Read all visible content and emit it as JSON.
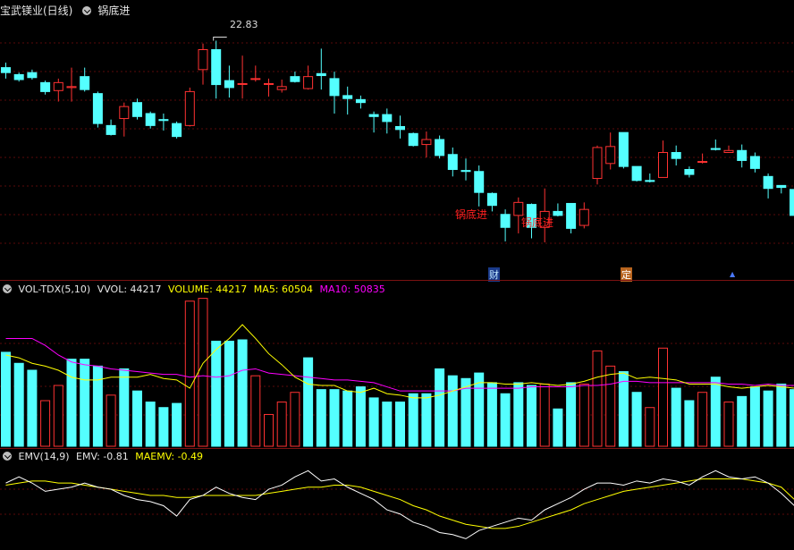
{
  "header": {
    "stock_name": "宝武镁业(日线)",
    "indicator_name": "锅底进"
  },
  "price_panel": {
    "high_label": "22.83",
    "signals": [
      "锅底进",
      "锅底进"
    ],
    "markers": {
      "fin": "财",
      "fix": "定",
      "up": "▲"
    },
    "colors": {
      "up": "#ff3232",
      "down": "#54ffff",
      "signal": "#ff2020"
    }
  },
  "vol_panel": {
    "name": "VOL-TDX(5,10)",
    "vvol": "VVOL: 44217",
    "volume": "VOLUME: 44217",
    "ma5": "MA5: 60504",
    "ma10": "MA10: 50835",
    "colors": {
      "ma5": "#ffff00",
      "ma10": "#ff00ff"
    }
  },
  "emv_panel": {
    "name": "EMV(14,9)",
    "emv": "EMV: -0.81",
    "maemv": "MAEMV: -0.49",
    "colors": {
      "emv": "#ffffff",
      "maemv": "#ffff00"
    }
  },
  "chart_data": [
    {
      "type": "candlestick",
      "series": [
        {
          "name": "price",
          "values": [
            [
              7.2,
              6.7,
              7.7,
              6.1
            ],
            [
              6.5,
              6.0,
              6.7,
              5.8
            ],
            [
              6.7,
              6.2,
              7.0,
              6.0
            ],
            [
              5.7,
              4.8,
              5.9,
              4.5
            ],
            [
              4.9,
              5.7,
              6.1,
              3.8
            ],
            [
              5.2,
              5.3,
              7.2,
              3.8
            ],
            [
              6.3,
              5.0,
              7.2,
              4.8
            ],
            [
              4.6,
              1.6,
              4.8,
              1.2
            ],
            [
              1.4,
              0.5,
              2.0,
              0.4
            ],
            [
              2.1,
              3.3,
              3.7,
              0.3
            ],
            [
              3.7,
              2.3,
              4.1,
              2.0
            ],
            [
              2.6,
              1.4,
              2.8,
              1.1
            ],
            [
              2.0,
              1.9,
              2.6,
              0.9
            ],
            [
              1.6,
              0.3,
              1.8,
              0.1
            ],
            [
              1.4,
              4.8,
              5.2,
              1.3
            ],
            [
              7.0,
              9.0,
              9.6,
              5.5
            ],
            [
              9.0,
              5.5,
              9.9,
              4.1
            ],
            [
              5.9,
              5.2,
              7.4,
              4.2
            ],
            [
              5.6,
              5.6,
              8.4,
              4.1
            ],
            [
              6.1,
              6.1,
              7.4,
              5.8
            ],
            [
              5.6,
              5.6,
              6.1,
              4.3
            ],
            [
              5.0,
              5.3,
              6.0,
              4.7
            ],
            [
              6.3,
              5.8,
              6.8,
              5.7
            ],
            [
              5.1,
              6.3,
              7.4,
              5.0
            ],
            [
              6.6,
              6.4,
              9.1,
              5.0
            ],
            [
              6.1,
              4.4,
              6.8,
              2.6
            ],
            [
              4.4,
              4.1,
              5.3,
              2.5
            ],
            [
              4.0,
              3.7,
              4.4,
              3.1
            ],
            [
              2.5,
              2.3,
              2.8,
              0.7
            ],
            [
              2.5,
              1.8,
              3.1,
              0.6
            ],
            [
              1.3,
              1.0,
              2.4,
              0.1
            ],
            [
              0.6,
              -0.6,
              0.7,
              -0.7
            ],
            [
              -0.5,
              0.0,
              0.8,
              -1.8
            ],
            [
              0.0,
              -1.6,
              0.4,
              -1.9
            ],
            [
              -1.5,
              -3.0,
              -0.8,
              -3.7
            ],
            [
              -3.1,
              -3.2,
              -1.9,
              -4.1
            ],
            [
              -3.2,
              -5.3,
              -2.6,
              -6.7
            ],
            [
              -5.4,
              -6.6,
              -5.3,
              -7.2
            ],
            [
              -7.5,
              -8.8,
              -7.0,
              -10.2
            ],
            [
              -7.6,
              -6.3,
              -5.8,
              -9.4
            ],
            [
              -6.5,
              -8.8,
              -6.4,
              -9.9
            ],
            [
              -8.8,
              -7.2,
              -4.9,
              -10.3
            ],
            [
              -7.2,
              -7.6,
              -6.4,
              -7.7
            ],
            [
              -6.4,
              -8.9,
              -6.4,
              -9.4
            ],
            [
              -8.6,
              -7.0,
              -6.3,
              -8.9
            ],
            [
              -3.9,
              -0.8,
              -0.6,
              -4.5
            ],
            [
              -2.4,
              -0.7,
              0.7,
              -3.0
            ],
            [
              0.7,
              -2.7,
              0.6,
              -2.9
            ],
            [
              -2.7,
              -4.1,
              -2.7,
              -4.2
            ],
            [
              -4.1,
              -4.2,
              -3.4,
              -4.3
            ],
            [
              -3.8,
              -1.3,
              -0.1,
              -3.7
            ],
            [
              -1.3,
              -1.9,
              -0.6,
              -2.6
            ],
            [
              -3.0,
              -3.5,
              -2.7,
              -3.8
            ],
            [
              -2.2,
              -2.2,
              -1.4,
              -2.4
            ],
            [
              -0.9,
              -1.0,
              0.0,
              -1.1
            ],
            [
              -1.3,
              -1.1,
              -0.6,
              -1.3
            ],
            [
              -1.1,
              -2.1,
              -0.5,
              -2.8
            ],
            [
              -1.7,
              -2.9,
              -1.3,
              -3.3
            ],
            [
              -3.7,
              -4.9,
              -3.4,
              -5.9
            ],
            [
              -4.6,
              -4.8,
              -4.6,
              -5.4
            ],
            [
              -5.0,
              -7.6,
              -4.8,
              -7.8
            ]
          ]
        }
      ],
      "ylim": [
        -12,
        12
      ]
    },
    {
      "type": "bar",
      "series": [
        {
          "name": "volume",
          "values": [
            68,
            60,
            55,
            33,
            44,
            63,
            63,
            58,
            37,
            56,
            40,
            32,
            28,
            31,
            105,
            107,
            76,
            76,
            77,
            51,
            23,
            32,
            39,
            64,
            41,
            41,
            40,
            43,
            35,
            32,
            32,
            38,
            38,
            56,
            51,
            49,
            53,
            46,
            38,
            46,
            44,
            45,
            27,
            46,
            45,
            69,
            58,
            54,
            39,
            28,
            71,
            42,
            33,
            39,
            50,
            32,
            36,
            43,
            40,
            45,
            41
          ],
          "direction": [
            "down",
            "down",
            "down",
            "up",
            "up",
            "down",
            "down",
            "down",
            "up",
            "down",
            "down",
            "down",
            "down",
            "down",
            "up",
            "up",
            "down",
            "down",
            "down",
            "up",
            "up",
            "up",
            "up",
            "down",
            "down",
            "down",
            "down",
            "down",
            "down",
            "down",
            "down",
            "down",
            "down",
            "down",
            "down",
            "down",
            "down",
            "down",
            "down",
            "down",
            "down",
            "up",
            "down",
            "down",
            "up",
            "up",
            "up",
            "down",
            "down",
            "up",
            "up",
            "down",
            "down",
            "up",
            "down",
            "up",
            "down",
            "down",
            "down",
            "down",
            "down"
          ]
        },
        {
          "name": "MA5",
          "values": [
            66,
            64,
            60,
            58,
            55,
            50,
            48,
            48,
            50,
            50,
            50,
            52,
            49,
            48,
            42,
            60,
            70,
            78,
            88,
            78,
            67,
            59,
            50,
            45,
            44,
            44,
            40,
            39,
            42,
            38,
            37,
            35,
            35,
            37,
            40,
            43,
            46,
            46,
            45,
            45,
            46,
            45,
            44,
            45,
            47,
            50,
            52,
            53,
            49,
            50,
            49,
            48,
            45,
            45,
            45,
            43,
            42,
            43,
            44,
            43,
            42
          ]
        },
        {
          "name": "MA10",
          "values": [
            78,
            78,
            78,
            73,
            66,
            61,
            59,
            58,
            56,
            55,
            54,
            53,
            52,
            52,
            50,
            51,
            50,
            51,
            55,
            56,
            53,
            52,
            51,
            50,
            49,
            48,
            48,
            47,
            46,
            43,
            40,
            40,
            40,
            40,
            40,
            42,
            42,
            42,
            42,
            42,
            43,
            43,
            43,
            43,
            44,
            44,
            45,
            47,
            47,
            46,
            46,
            46,
            46,
            46,
            46,
            45,
            45,
            44,
            45,
            44,
            44
          ]
        }
      ]
    },
    {
      "type": "line",
      "series": [
        {
          "name": "EMV",
          "values": [
            0.3,
            0.6,
            0.3,
            -0.1,
            0.0,
            0.1,
            0.3,
            0.1,
            0.0,
            -0.3,
            -0.5,
            -0.6,
            -0.8,
            -1.3,
            -0.5,
            -0.3,
            0.1,
            -0.2,
            -0.4,
            -0.5,
            0.0,
            0.2,
            0.6,
            0.9,
            0.4,
            0.5,
            0.1,
            -0.2,
            -0.5,
            -1.0,
            -1.2,
            -1.6,
            -1.8,
            -2.1,
            -2.2,
            -2.4,
            -2.0,
            -1.8,
            -1.6,
            -1.4,
            -1.5,
            -1.0,
            -0.7,
            -0.4,
            0.0,
            0.3,
            0.3,
            0.2,
            0.4,
            0.3,
            0.5,
            0.4,
            0.2,
            0.6,
            0.9,
            0.6,
            0.5,
            0.6,
            0.3,
            -0.2,
            -0.8
          ]
        },
        {
          "name": "MAEMV",
          "values": [
            0.2,
            0.3,
            0.4,
            0.4,
            0.3,
            0.3,
            0.2,
            0.1,
            0.0,
            -0.1,
            -0.2,
            -0.3,
            -0.3,
            -0.4,
            -0.4,
            -0.3,
            -0.3,
            -0.3,
            -0.3,
            -0.3,
            -0.2,
            -0.1,
            0.0,
            0.1,
            0.1,
            0.2,
            0.2,
            0.1,
            -0.1,
            -0.3,
            -0.5,
            -0.8,
            -1.0,
            -1.3,
            -1.5,
            -1.7,
            -1.8,
            -1.9,
            -1.9,
            -1.8,
            -1.6,
            -1.4,
            -1.2,
            -1.0,
            -0.7,
            -0.5,
            -0.3,
            -0.1,
            0.0,
            0.1,
            0.2,
            0.3,
            0.4,
            0.5,
            0.5,
            0.5,
            0.5,
            0.4,
            0.3,
            0.1,
            -0.5
          ]
        }
      ]
    }
  ]
}
